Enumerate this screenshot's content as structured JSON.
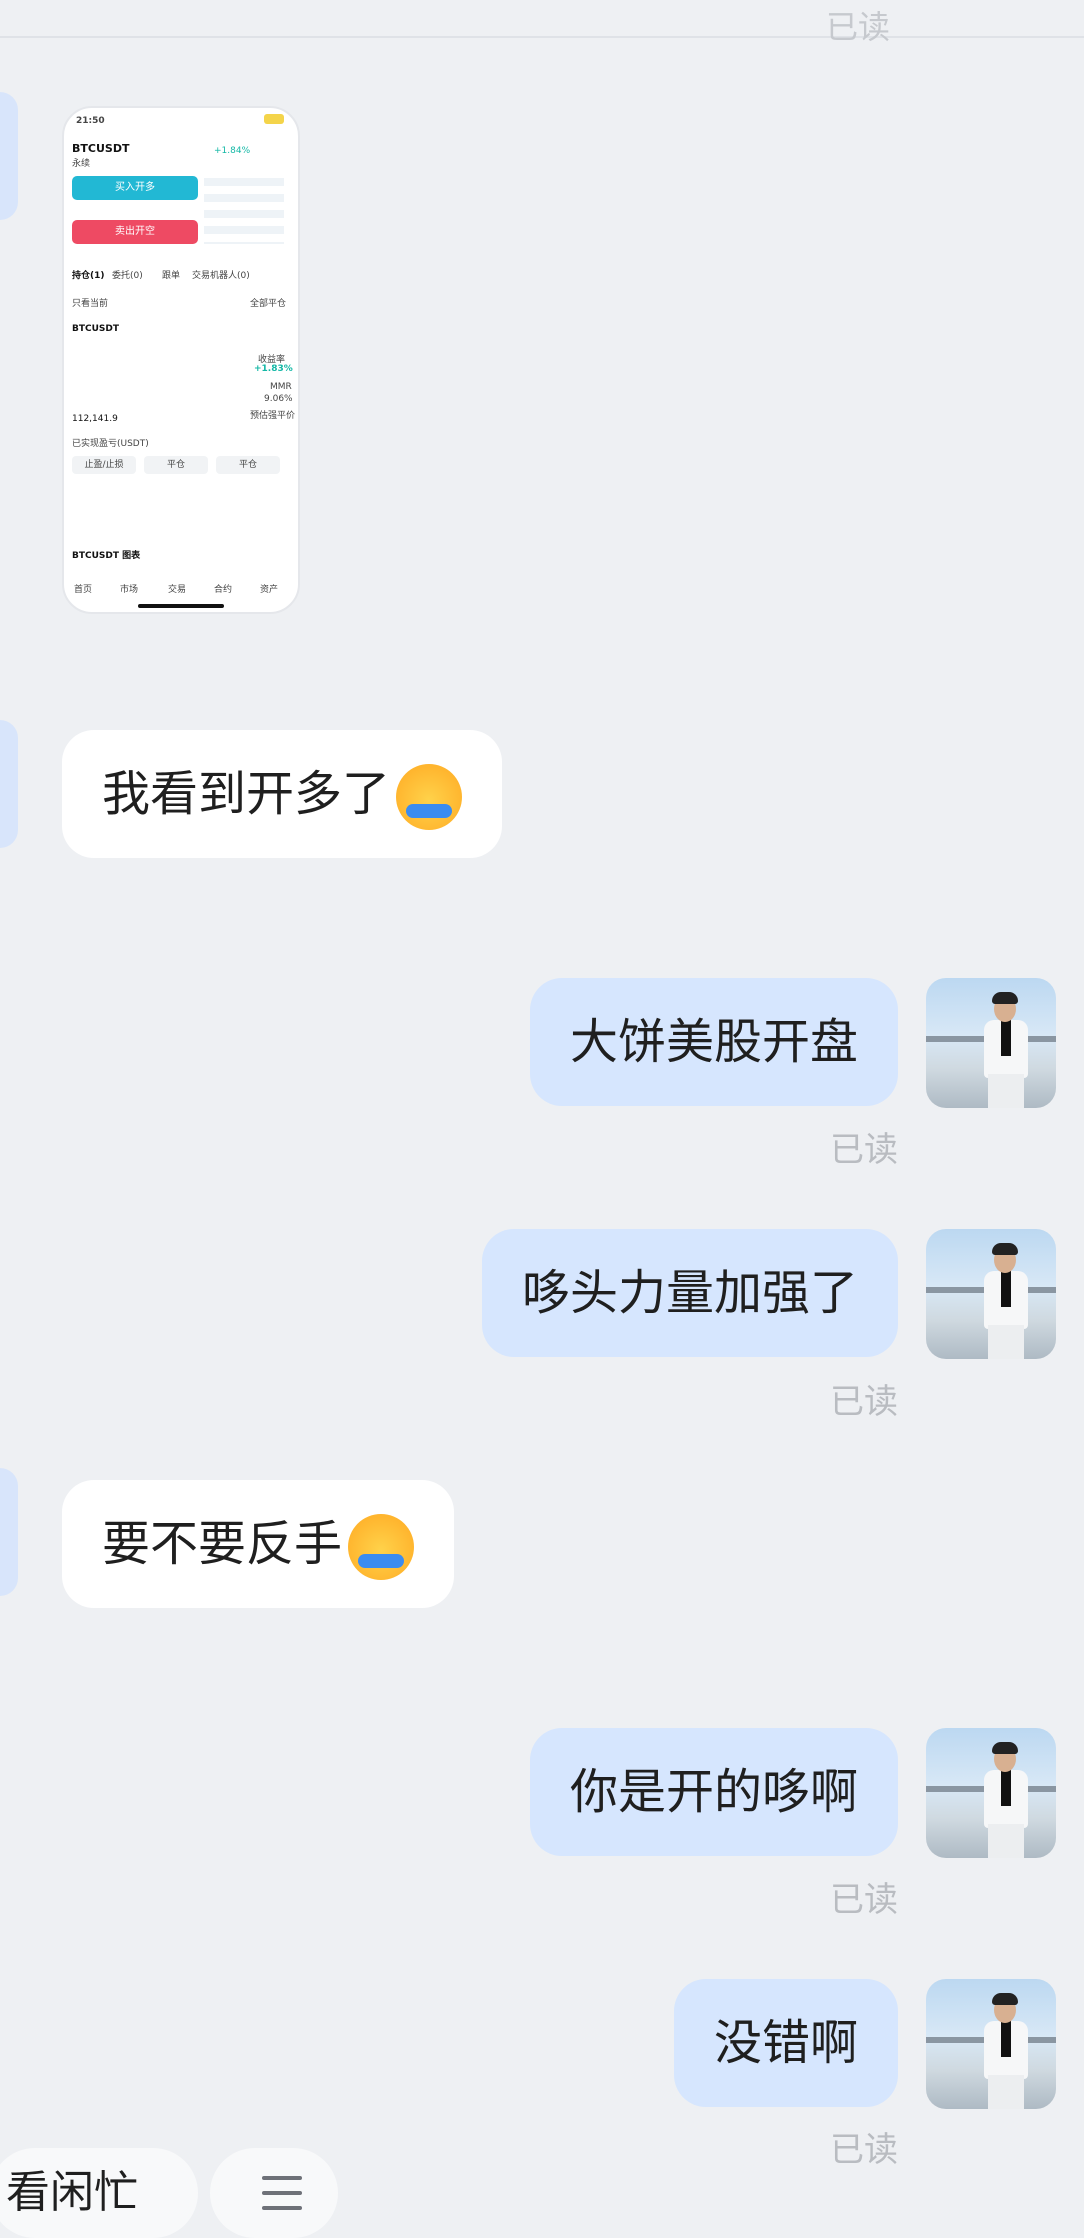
{
  "header": {
    "top_label": "/ 读",
    "top_read": "已读"
  },
  "screenshot_thumb": {
    "time": "21:50",
    "pair": "BTCUSDT",
    "type": "永续",
    "change": "+1.84%",
    "buy_label": "买入开多",
    "sell_label": "卖出开空",
    "tabs": [
      "持仓(1)",
      "委托(0)",
      "跟单",
      "交易机器人(0)"
    ],
    "only_current": "只看当前",
    "close_all": "全部平仓",
    "position_symbol": "BTCUSDT",
    "yield_label": "收益率",
    "yield_value": "+1.83%",
    "mmr_label": "MMR",
    "mmr_value": "9.06%",
    "entry_price": "112,141.9",
    "est_liq_label": "预估强平价",
    "realized_label": "已实现盈亏(USDT)",
    "actions": [
      "止盈/止损",
      "平仓",
      "平仓"
    ],
    "chart_label": "BTCUSDT 图表",
    "nav": [
      "首页",
      "市场",
      "交易",
      "合约",
      "资产"
    ]
  },
  "messages": [
    {
      "side": "in",
      "text": "我看到开多了"
    },
    {
      "side": "out",
      "text": "大饼美股开盘",
      "status": "已读"
    },
    {
      "side": "out",
      "text": "哆头力量加强了",
      "status": "已读"
    },
    {
      "side": "in",
      "text": "要不要反手"
    },
    {
      "side": "out",
      "text": "你是开的哆啊",
      "status": "已读"
    },
    {
      "side": "out",
      "text": "没错啊",
      "status": "已读"
    }
  ],
  "bottom": {
    "quick_reply": "看闲忙",
    "menu_icon": "menu-icon"
  },
  "colors": {
    "incoming_bubble": "#ffffff",
    "outgoing_bubble": "#d6e6fe",
    "read_text": "#b9bcc1"
  }
}
